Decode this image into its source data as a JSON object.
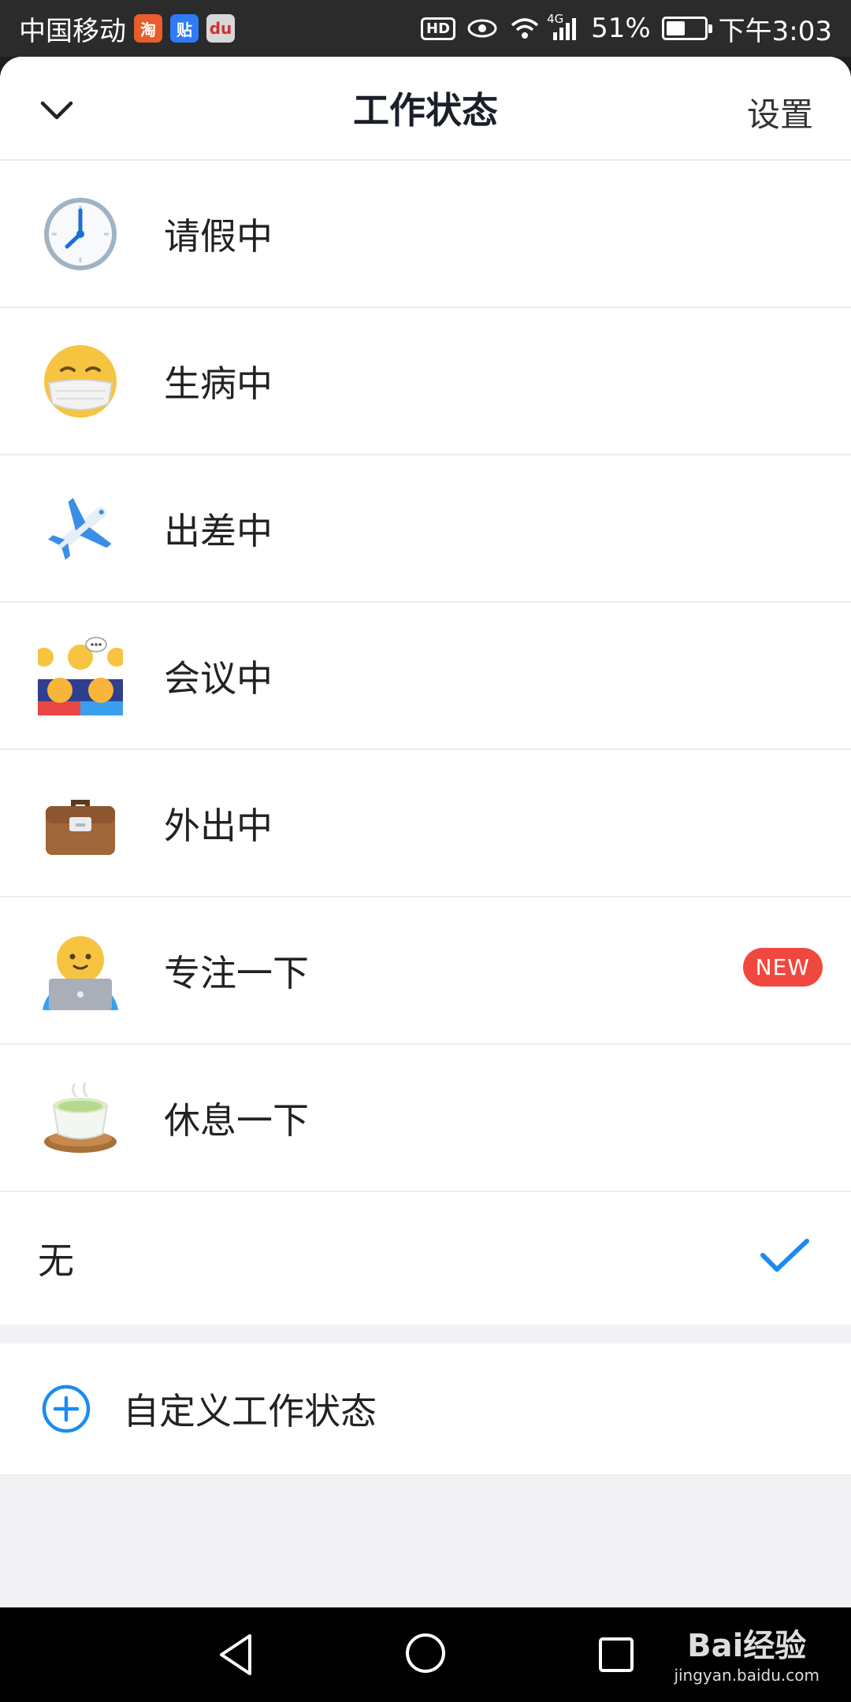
{
  "status_bar": {
    "carrier": "中国移动",
    "app_icons": [
      {
        "name": "taobao-icon",
        "glyph": "淘",
        "color": "#e85d2b"
      },
      {
        "name": "tieba-icon",
        "glyph": "贴",
        "color": "#2d7cf6"
      },
      {
        "name": "baidu-map-icon",
        "glyph": "du",
        "color": "#d8d8d8"
      }
    ],
    "hd": "HD",
    "network": "4G",
    "battery_percent": "51%",
    "battery_level": 0.51,
    "time": "下午3:03"
  },
  "header": {
    "title": "工作状态",
    "settings": "设置"
  },
  "statuses": [
    {
      "label": "请假中",
      "icon": "clock-icon"
    },
    {
      "label": "生病中",
      "icon": "mask-face-icon"
    },
    {
      "label": "出差中",
      "icon": "airplane-icon"
    },
    {
      "label": "会议中",
      "icon": "meeting-icon"
    },
    {
      "label": "外出中",
      "icon": "briefcase-icon"
    },
    {
      "label": "专注一下",
      "icon": "laptop-person-icon",
      "badge": "NEW"
    },
    {
      "label": "休息一下",
      "icon": "tea-icon"
    }
  ],
  "none_option": {
    "label": "无",
    "selected": true
  },
  "custom": {
    "label": "自定义工作状态"
  },
  "colors": {
    "accent": "#1a8cf0",
    "badge": "#f0483e"
  },
  "watermark": {
    "top": "Bai经验",
    "bottom": "jingyan.baidu.com"
  }
}
